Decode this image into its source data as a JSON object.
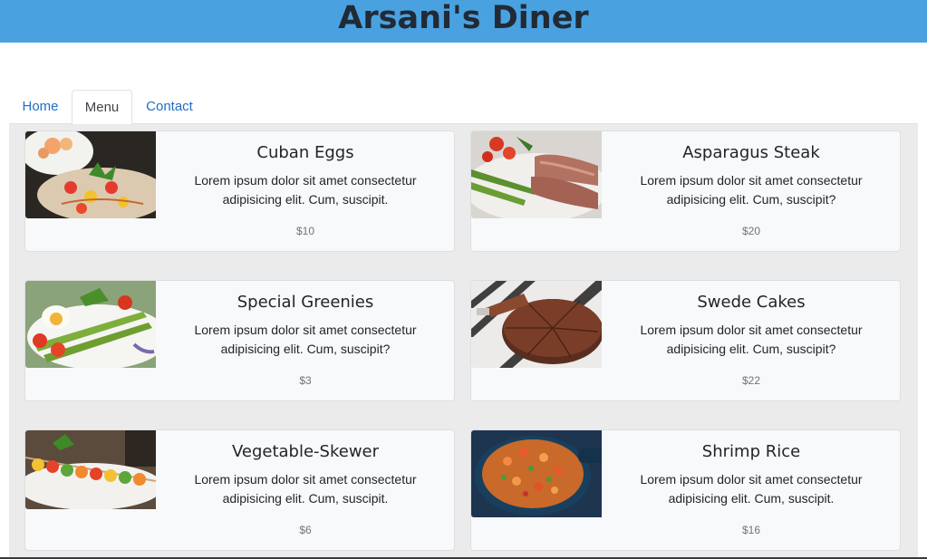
{
  "header": {
    "title": "Arsani's Diner"
  },
  "tabs": [
    {
      "label": "Home",
      "active": false
    },
    {
      "label": "Menu",
      "active": true
    },
    {
      "label": "Contact",
      "active": false
    }
  ],
  "menu": [
    {
      "name": "Cuban Eggs",
      "description": "Lorem ipsum dolor sit amet consectetur adipisicing elit. Cum, suscipit.",
      "price": "$10",
      "image": "salad-bowl-image"
    },
    {
      "name": "Asparagus Steak",
      "description": "Lorem ipsum dolor sit amet consectetur adipisicing elit. Cum, suscipit?",
      "price": "$20",
      "image": "steak-asparagus-image"
    },
    {
      "name": "Special Greenies",
      "description": "Lorem ipsum dolor sit amet consectetur adipisicing elit. Cum, suscipit?",
      "price": "$3",
      "image": "asparagus-egg-salad-image"
    },
    {
      "name": "Swede Cakes",
      "description": "Lorem ipsum dolor sit amet consectetur adipisicing elit. Cum, suscipit?",
      "price": "$22",
      "image": "chocolate-cake-image"
    },
    {
      "name": "Vegetable-Skewer",
      "description": "Lorem ipsum dolor sit amet consectetur adipisicing elit. Cum, suscipit.",
      "price": "$6",
      "image": "vegetable-skewer-image"
    },
    {
      "name": "Shrimp Rice",
      "description": "Lorem ipsum dolor sit amet consectetur adipisicing elit. Cum, suscipit.",
      "price": "$16",
      "image": "shrimp-rice-pan-image"
    }
  ],
  "colors": {
    "header_bg": "#4aa1e0",
    "link": "#1f6fc4",
    "menu_bg": "#ebebeb",
    "card_bg": "#f8f9fa"
  }
}
